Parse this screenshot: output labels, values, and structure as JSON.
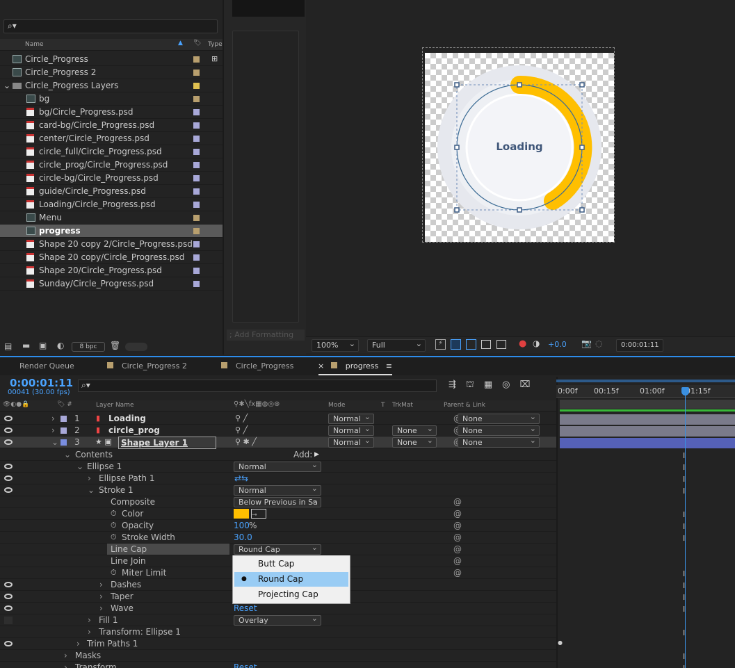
{
  "project": {
    "header": {
      "name": "Name",
      "type": "Type"
    },
    "items": [
      {
        "name": "Circle_Progress",
        "kind": "comp",
        "indent": 0,
        "label": "#b89f6e"
      },
      {
        "name": "Circle_Progress 2",
        "kind": "comp",
        "indent": 0,
        "label": "#b89f6e"
      },
      {
        "name": "Circle_Progress Layers",
        "kind": "folder",
        "indent": 0,
        "label": "#e0c050"
      },
      {
        "name": "bg",
        "kind": "comp",
        "indent": 1,
        "label": "#b89f6e"
      },
      {
        "name": "bg/Circle_Progress.psd",
        "kind": "psd",
        "indent": 1,
        "label": "#a8a8d8"
      },
      {
        "name": "card-bg/Circle_Progress.psd",
        "kind": "psd",
        "indent": 1,
        "label": "#a8a8d8"
      },
      {
        "name": "center/Circle_Progress.psd",
        "kind": "psd",
        "indent": 1,
        "label": "#a8a8d8"
      },
      {
        "name": "circle_full/Circle_Progress.psd",
        "kind": "psd",
        "indent": 1,
        "label": "#a8a8d8"
      },
      {
        "name": "circle_prog/Circle_Progress.psd",
        "kind": "psd",
        "indent": 1,
        "label": "#a8a8d8"
      },
      {
        "name": "circle-bg/Circle_Progress.psd",
        "kind": "psd",
        "indent": 1,
        "label": "#a8a8d8"
      },
      {
        "name": "guide/Circle_Progress.psd",
        "kind": "psd",
        "indent": 1,
        "label": "#a8a8d8"
      },
      {
        "name": "Loading/Circle_Progress.psd",
        "kind": "psd",
        "indent": 1,
        "label": "#a8a8d8"
      },
      {
        "name": "Menu",
        "kind": "comp",
        "indent": 1,
        "label": "#b89f6e"
      },
      {
        "name": "progress",
        "kind": "comp",
        "indent": 1,
        "label": "#b89f6e",
        "selected": true
      },
      {
        "name": "Shape 20 copy 2/Circle_Progress.psd",
        "kind": "psd",
        "indent": 1,
        "label": "#a8a8d8"
      },
      {
        "name": "Shape 20 copy/Circle_Progress.psd",
        "kind": "psd",
        "indent": 1,
        "label": "#a8a8d8"
      },
      {
        "name": "Shape 20/Circle_Progress.psd",
        "kind": "psd",
        "indent": 1,
        "label": "#a8a8d8"
      },
      {
        "name": "Sunday/Circle_Progress.psd",
        "kind": "psd",
        "indent": 1,
        "label": "#a8a8d8"
      }
    ],
    "footer": {
      "bpc": "8 bpc"
    }
  },
  "middle": {
    "add_formatting": "Add Formatting"
  },
  "viewer": {
    "canvas_text": "Loading",
    "zoom": "100%",
    "resolution": "Full",
    "exposure": "+0.0",
    "timecode": "0:00:01:11",
    "accent": "#ffbf00"
  },
  "timeline": {
    "tabs": [
      {
        "label": "Render Queue"
      },
      {
        "label": "Circle_Progress 2"
      },
      {
        "label": "Circle_Progress"
      },
      {
        "label": "progress",
        "active": true
      }
    ],
    "time": "0:00:01:11",
    "fps": "00041 (30.00 fps)",
    "columns": {
      "layer_name": "Layer Name",
      "mode": "Mode",
      "t": "T",
      "trkmat": "TrkMat",
      "parent": "Parent & Link"
    },
    "layers": [
      {
        "num": "1",
        "name": "Loading",
        "mode": "Normal",
        "trkmat": "",
        "parent": "None",
        "color": "#a8a8d8"
      },
      {
        "num": "2",
        "name": "circle_prog",
        "mode": "Normal",
        "trkmat": "None",
        "parent": "None",
        "color": "#a8a8d8"
      },
      {
        "num": "3",
        "name": "Shape Layer 1",
        "mode": "Normal",
        "trkmat": "None",
        "parent": "None",
        "color": "#7a8ee0"
      }
    ],
    "props": {
      "contents": "Contents",
      "add": "Add:",
      "ellipse": "Ellipse 1",
      "ellipse_mode": "Normal",
      "ellipse_path": "Ellipse Path 1",
      "stroke": "Stroke 1",
      "stroke_mode": "Normal",
      "composite": "Composite",
      "composite_value": "Below Previous in Sa",
      "color": "Color",
      "opacity": "Opacity",
      "opacity_value": "100",
      "opacity_unit": "%",
      "stroke_width": "Stroke Width",
      "stroke_width_value": "30.0",
      "line_cap": "Line Cap",
      "line_cap_value": "Round Cap",
      "line_join": "Line Join",
      "miter_limit": "Miter Limit",
      "dashes": "Dashes",
      "taper": "Taper",
      "wave": "Wave",
      "reset": "Reset",
      "fill": "Fill 1",
      "fill_mode": "Overlay",
      "transform_ellipse": "Transform: Ellipse 1",
      "trim_paths": "Trim Paths 1",
      "masks": "Masks",
      "transform": "Transform",
      "reset2": "Reset"
    },
    "ruler": [
      "0:00f",
      "00:15f",
      "01:00f",
      "01:15f"
    ]
  },
  "popup": {
    "items": [
      "Butt Cap",
      "Round Cap",
      "Projecting Cap"
    ],
    "selected_index": 1
  }
}
